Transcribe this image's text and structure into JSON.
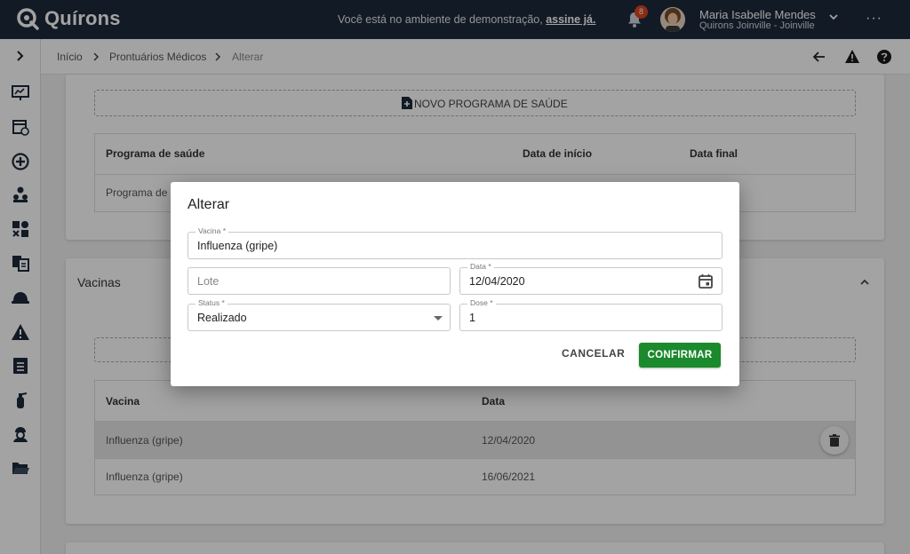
{
  "topbar": {
    "logo_text": "Quírons",
    "demo_message": "Você está no ambiente de demonstração, ",
    "demo_link": "assine já.",
    "notification_count": "8",
    "user_name": "Maria Isabelle Mendes",
    "user_unit": "Quirons Joinville - Joinville",
    "more_label": "···"
  },
  "breadcrumb": {
    "items": [
      "Início",
      "Prontuários Médicos",
      "Alterar"
    ]
  },
  "health_programs": {
    "new_button": "NOVO PROGRAMA DE SAÚDE",
    "columns": [
      "Programa de saúde",
      "Data de início",
      "Data final"
    ],
    "rows": [
      [
        "Programa de C",
        "",
        ""
      ]
    ]
  },
  "vaccines": {
    "title": "Vacinas",
    "columns": [
      "Vacina",
      "Data"
    ],
    "rows": [
      {
        "vacina": "Influenza (gripe)",
        "data": "12/04/2020"
      },
      {
        "vacina": "Influenza (gripe)",
        "data": "16/06/2021"
      }
    ]
  },
  "dialog": {
    "title": "Alterar",
    "vacina_label": "Vacina *",
    "vacina_value": "Influenza (gripe)",
    "lote_placeholder": "Lote",
    "data_label": "Data *",
    "data_value": "12/04/2020",
    "status_label": "Status *",
    "status_value": "Realizado",
    "dose_label": "Dose *",
    "dose_value": "1",
    "cancel_label": "CANCELAR",
    "confirm_label": "CONFIRMAR"
  },
  "colors": {
    "topbar": "#1d2a3a",
    "confirm": "#1a8a2c",
    "badge": "#d9451f"
  }
}
